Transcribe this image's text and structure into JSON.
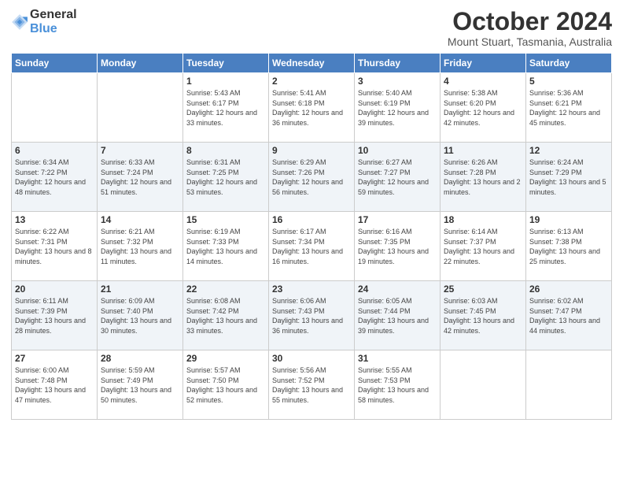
{
  "logo": {
    "general": "General",
    "blue": "Blue"
  },
  "header": {
    "month": "October 2024",
    "location": "Mount Stuart, Tasmania, Australia"
  },
  "days_of_week": [
    "Sunday",
    "Monday",
    "Tuesday",
    "Wednesday",
    "Thursday",
    "Friday",
    "Saturday"
  ],
  "weeks": [
    [
      {
        "day": "",
        "info": ""
      },
      {
        "day": "",
        "info": ""
      },
      {
        "day": "1",
        "info": "Sunrise: 5:43 AM\nSunset: 6:17 PM\nDaylight: 12 hours and 33 minutes."
      },
      {
        "day": "2",
        "info": "Sunrise: 5:41 AM\nSunset: 6:18 PM\nDaylight: 12 hours and 36 minutes."
      },
      {
        "day": "3",
        "info": "Sunrise: 5:40 AM\nSunset: 6:19 PM\nDaylight: 12 hours and 39 minutes."
      },
      {
        "day": "4",
        "info": "Sunrise: 5:38 AM\nSunset: 6:20 PM\nDaylight: 12 hours and 42 minutes."
      },
      {
        "day": "5",
        "info": "Sunrise: 5:36 AM\nSunset: 6:21 PM\nDaylight: 12 hours and 45 minutes."
      }
    ],
    [
      {
        "day": "6",
        "info": "Sunrise: 6:34 AM\nSunset: 7:22 PM\nDaylight: 12 hours and 48 minutes."
      },
      {
        "day": "7",
        "info": "Sunrise: 6:33 AM\nSunset: 7:24 PM\nDaylight: 12 hours and 51 minutes."
      },
      {
        "day": "8",
        "info": "Sunrise: 6:31 AM\nSunset: 7:25 PM\nDaylight: 12 hours and 53 minutes."
      },
      {
        "day": "9",
        "info": "Sunrise: 6:29 AM\nSunset: 7:26 PM\nDaylight: 12 hours and 56 minutes."
      },
      {
        "day": "10",
        "info": "Sunrise: 6:27 AM\nSunset: 7:27 PM\nDaylight: 12 hours and 59 minutes."
      },
      {
        "day": "11",
        "info": "Sunrise: 6:26 AM\nSunset: 7:28 PM\nDaylight: 13 hours and 2 minutes."
      },
      {
        "day": "12",
        "info": "Sunrise: 6:24 AM\nSunset: 7:29 PM\nDaylight: 13 hours and 5 minutes."
      }
    ],
    [
      {
        "day": "13",
        "info": "Sunrise: 6:22 AM\nSunset: 7:31 PM\nDaylight: 13 hours and 8 minutes."
      },
      {
        "day": "14",
        "info": "Sunrise: 6:21 AM\nSunset: 7:32 PM\nDaylight: 13 hours and 11 minutes."
      },
      {
        "day": "15",
        "info": "Sunrise: 6:19 AM\nSunset: 7:33 PM\nDaylight: 13 hours and 14 minutes."
      },
      {
        "day": "16",
        "info": "Sunrise: 6:17 AM\nSunset: 7:34 PM\nDaylight: 13 hours and 16 minutes."
      },
      {
        "day": "17",
        "info": "Sunrise: 6:16 AM\nSunset: 7:35 PM\nDaylight: 13 hours and 19 minutes."
      },
      {
        "day": "18",
        "info": "Sunrise: 6:14 AM\nSunset: 7:37 PM\nDaylight: 13 hours and 22 minutes."
      },
      {
        "day": "19",
        "info": "Sunrise: 6:13 AM\nSunset: 7:38 PM\nDaylight: 13 hours and 25 minutes."
      }
    ],
    [
      {
        "day": "20",
        "info": "Sunrise: 6:11 AM\nSunset: 7:39 PM\nDaylight: 13 hours and 28 minutes."
      },
      {
        "day": "21",
        "info": "Sunrise: 6:09 AM\nSunset: 7:40 PM\nDaylight: 13 hours and 30 minutes."
      },
      {
        "day": "22",
        "info": "Sunrise: 6:08 AM\nSunset: 7:42 PM\nDaylight: 13 hours and 33 minutes."
      },
      {
        "day": "23",
        "info": "Sunrise: 6:06 AM\nSunset: 7:43 PM\nDaylight: 13 hours and 36 minutes."
      },
      {
        "day": "24",
        "info": "Sunrise: 6:05 AM\nSunset: 7:44 PM\nDaylight: 13 hours and 39 minutes."
      },
      {
        "day": "25",
        "info": "Sunrise: 6:03 AM\nSunset: 7:45 PM\nDaylight: 13 hours and 42 minutes."
      },
      {
        "day": "26",
        "info": "Sunrise: 6:02 AM\nSunset: 7:47 PM\nDaylight: 13 hours and 44 minutes."
      }
    ],
    [
      {
        "day": "27",
        "info": "Sunrise: 6:00 AM\nSunset: 7:48 PM\nDaylight: 13 hours and 47 minutes."
      },
      {
        "day": "28",
        "info": "Sunrise: 5:59 AM\nSunset: 7:49 PM\nDaylight: 13 hours and 50 minutes."
      },
      {
        "day": "29",
        "info": "Sunrise: 5:57 AM\nSunset: 7:50 PM\nDaylight: 13 hours and 52 minutes."
      },
      {
        "day": "30",
        "info": "Sunrise: 5:56 AM\nSunset: 7:52 PM\nDaylight: 13 hours and 55 minutes."
      },
      {
        "day": "31",
        "info": "Sunrise: 5:55 AM\nSunset: 7:53 PM\nDaylight: 13 hours and 58 minutes."
      },
      {
        "day": "",
        "info": ""
      },
      {
        "day": "",
        "info": ""
      }
    ]
  ]
}
